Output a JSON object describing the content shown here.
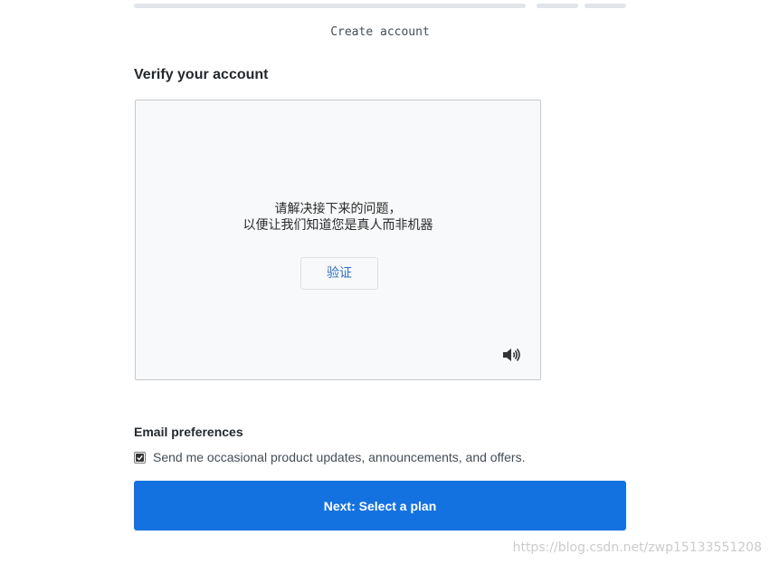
{
  "progress": {
    "steps": 3
  },
  "step_label": "Create account",
  "verify": {
    "title": "Verify your account",
    "captcha": {
      "prompt_line1": "请解决接下来的问题，",
      "prompt_line2": "以便让我们知道您是真人而非机器",
      "verify_label": "验证",
      "audio_icon": "speaker-icon"
    }
  },
  "email_preferences": {
    "title": "Email preferences",
    "option_label": "Send me occasional product updates, announcements, and offers.",
    "option_checked": true
  },
  "next_button_label": "Next: Select a plan",
  "watermark": "https://blog.csdn.net/zwp15133551208",
  "colors": {
    "primary": "#1472e0",
    "progress_track": "#e1e4e8",
    "captcha_bg": "#f8f9fa",
    "link": "#2f6fc6"
  }
}
